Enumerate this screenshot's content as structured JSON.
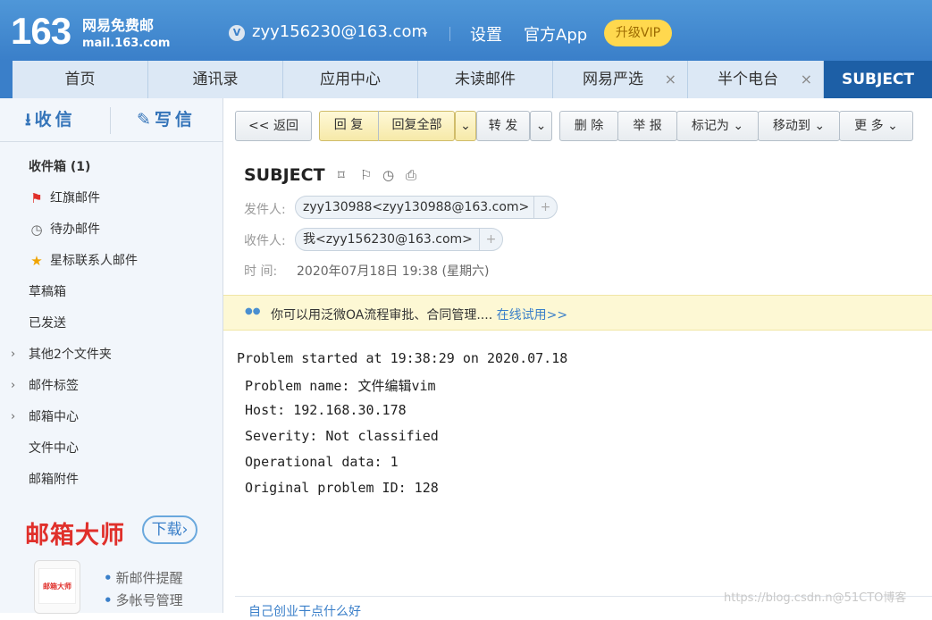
{
  "header": {
    "logo_number": "163",
    "logo_name": "网易免费邮",
    "logo_domain": "mail.163.com",
    "account": "zyy156230@163.com",
    "settings": "设置",
    "app": "官方App",
    "vip": "升级VIP"
  },
  "tabs": [
    {
      "label": "首页"
    },
    {
      "label": "通讯录"
    },
    {
      "label": "应用中心"
    },
    {
      "label": "未读邮件"
    },
    {
      "label": "网易严选",
      "close": "×"
    },
    {
      "label": "半个电台",
      "close": "×"
    },
    {
      "label": "SUBJECT"
    }
  ],
  "sidebar": {
    "receive": "收信",
    "write": "写信",
    "items": [
      {
        "label": "收件箱 (1)"
      },
      {
        "label": "红旗邮件"
      },
      {
        "label": "待办邮件"
      },
      {
        "label": "星标联系人邮件"
      },
      {
        "label": "草稿箱"
      },
      {
        "label": "已发送"
      },
      {
        "label": "其他2个文件夹"
      },
      {
        "label": "邮件标签"
      },
      {
        "label": "邮箱中心"
      },
      {
        "label": "文件中心"
      },
      {
        "label": "邮箱附件"
      }
    ],
    "promo_title": "邮箱大师",
    "promo_download": "下载",
    "phone_label": "邮箱大师",
    "features": [
      "新邮件提醒",
      "多帐号管理"
    ]
  },
  "toolbar": {
    "back": "<< 返回",
    "reply": "回 复",
    "reply_all": "回复全部",
    "forward": "转 发",
    "delete": "删 除",
    "report": "举 报",
    "mark_as": "标记为",
    "move_to": "移动到",
    "more": "更 多"
  },
  "mail": {
    "subject": "SUBJECT",
    "from_label": "发件人:",
    "from": "zyy130988<zyy130988@163.com>",
    "to_label": "收件人:",
    "to": "我<zyy156230@163.com>",
    "time_label": "时 间:",
    "time": "2020年07月18日 19:38 (星期六)",
    "banner_text": "你可以用泛微OA流程审批、合同管理....",
    "banner_link": "在线试用>>",
    "body": [
      "Problem started at 19:38:29 on 2020.07.18",
      " Problem name: 文件编辑vim",
      " Host: 192.168.30.178",
      " Severity: Not classified",
      " Operational data: 1",
      " Original problem ID: 128"
    ]
  },
  "footer": {
    "link": "自己创业干点什么好",
    "watermark": "https://blog.csdn.n@51CTO博客"
  }
}
